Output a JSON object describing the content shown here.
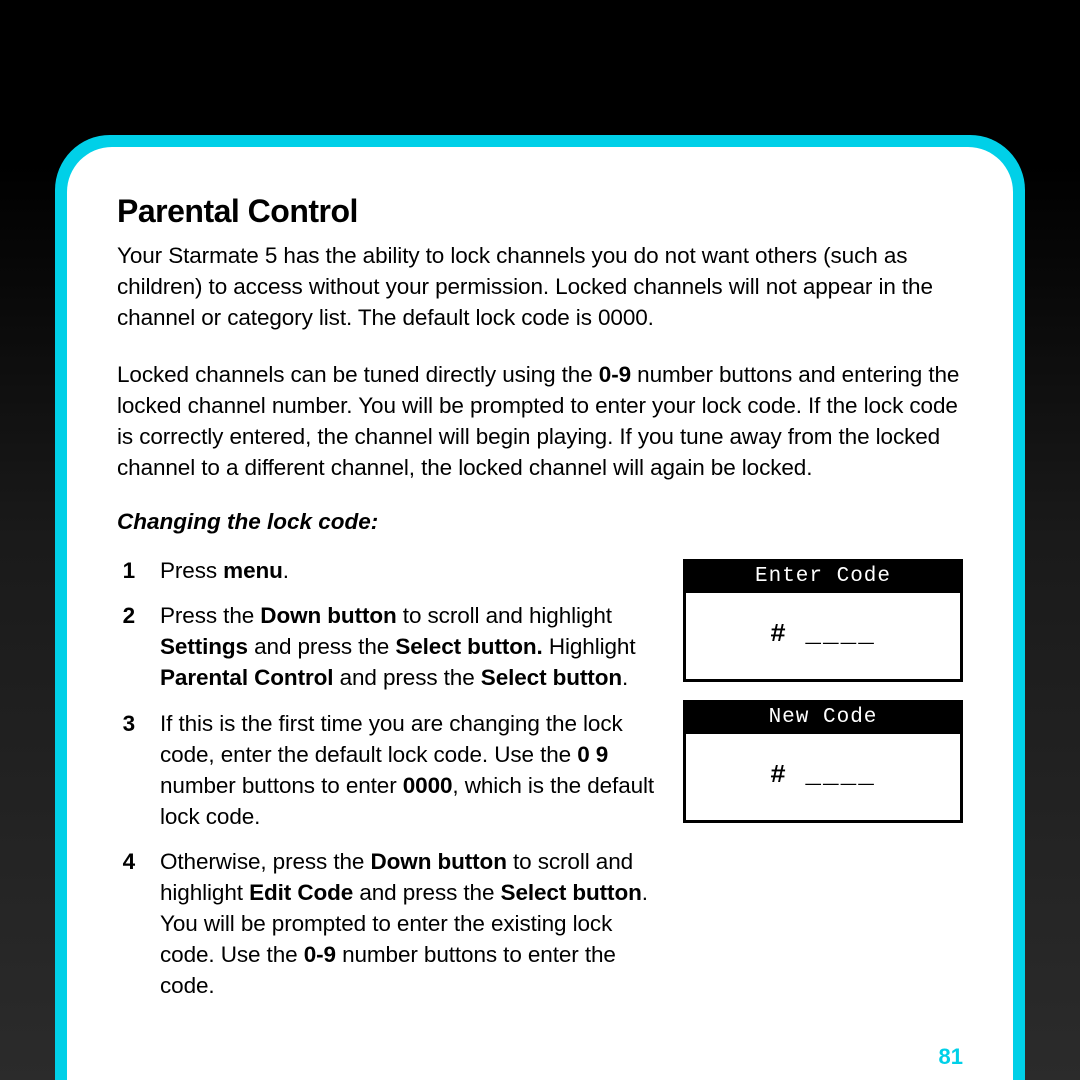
{
  "title": "Parental Control",
  "para1": "Your Starmate 5 has the ability to lock channels you do not want others (such as children) to access without your permission. Locked channels will not appear in the channel or category list. The default lock code is 0000.",
  "para2_pre": "Locked channels can be tuned directly using the ",
  "para2_b1": "0-9",
  "para2_post": " number buttons and entering the locked channel number. You will be prompted to enter your lock code. If the lock code is correctly entered, the channel will begin playing. If you tune away from the locked channel to a different channel, the locked channel will again be locked.",
  "subheading": "Changing the lock code:",
  "steps": {
    "s1": {
      "num": "1",
      "t1": "Press ",
      "b1": "menu",
      "t2": "."
    },
    "s2": {
      "num": "2",
      "t1": "Press the ",
      "b1": "Down button",
      "t2": " to scroll and highlight ",
      "b2": "Settings",
      "t3": " and press the ",
      "b3": "Select button.",
      "t4": " Highlight ",
      "b4": "Parental Control",
      "t5": " and press the ",
      "b5": "Select button",
      "t6": "."
    },
    "s3": {
      "num": "3",
      "t1": "If this is the first time you are changing the lock code, enter the default lock code. Use the ",
      "b1": "0  9",
      "t2": " number buttons to enter ",
      "b2": "0000",
      "t3": ", which is the default lock code."
    },
    "s4": {
      "num": "4",
      "t1": "Otherwise, press the ",
      "b1": "Down button",
      "t2": " to scroll and highlight ",
      "b2": "Edit Code",
      "t3": " and press the ",
      "b3": "Select button",
      "t4": ". You will be prompted to enter the existing lock code. Use the ",
      "b4": "0-9",
      "t5": " number buttons to enter the code."
    }
  },
  "screens": {
    "a": {
      "header": "Enter Code",
      "body": "# ____"
    },
    "b": {
      "header": "New Code",
      "body": "# ____"
    }
  },
  "page_number": "81"
}
